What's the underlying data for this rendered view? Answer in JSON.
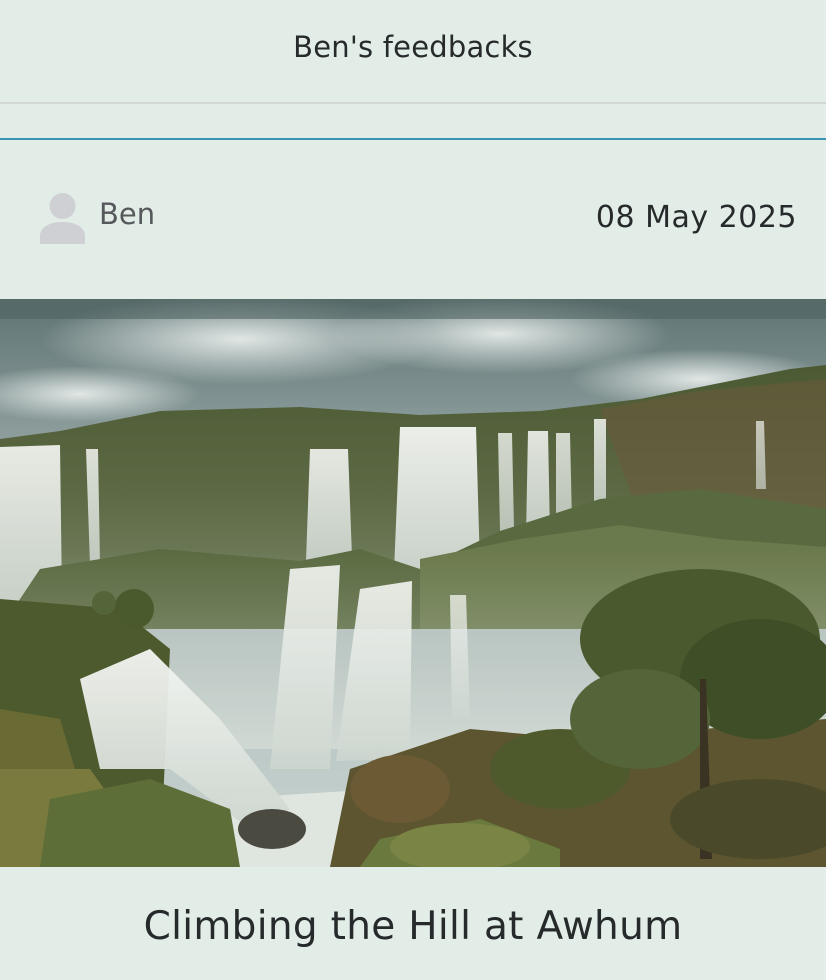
{
  "header": {
    "title": "Ben's feedbacks"
  },
  "post": {
    "author": {
      "name": "Ben",
      "avatar_icon": "person-placeholder-icon"
    },
    "date": "08 May 2025",
    "image": {
      "subject": "waterfalls",
      "alt": ""
    },
    "title": "Climbing the Hill at Awhum"
  },
  "colors": {
    "background": "#e3ede7",
    "accent_line": "#3b93b5",
    "divider": "#d2d8d4",
    "text_primary": "#262a2b",
    "text_secondary": "#55595b",
    "avatar": "#cfd0d3"
  }
}
